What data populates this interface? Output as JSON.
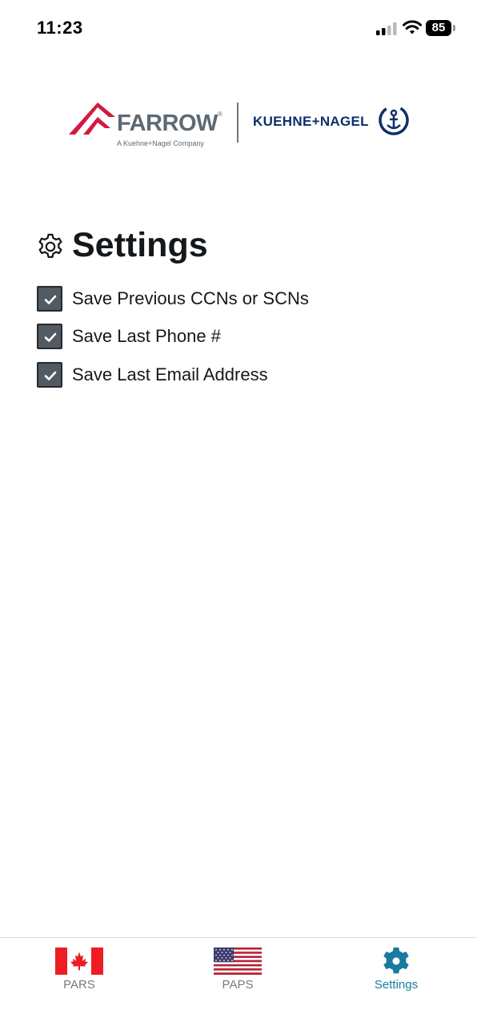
{
  "status_bar": {
    "time": "11:23",
    "battery_percent": "85"
  },
  "header": {
    "logo_farrow": "FARROW",
    "logo_farrow_registered": "®",
    "logo_farrow_tagline": "A Kuehne+Nagel Company",
    "logo_kuehne_nagel": "KUEHNE+NAGEL"
  },
  "settings": {
    "title": "Settings",
    "options": [
      {
        "label": "Save Previous CCNs or SCNs",
        "checked": true
      },
      {
        "label": "Save Last Phone #",
        "checked": true
      },
      {
        "label": "Save Last Email Address",
        "checked": true
      }
    ]
  },
  "tabs": [
    {
      "label": "PARS",
      "icon": "canada-flag-icon",
      "active": false
    },
    {
      "label": "PAPS",
      "icon": "usa-flag-icon",
      "active": false
    },
    {
      "label": "Settings",
      "icon": "gear-icon",
      "active": true
    }
  ],
  "colors": {
    "checkbox_fill": "#525a63",
    "active_tab": "#1a7aa0",
    "farrow_red": "#d3193f",
    "kn_blue": "#0c2f6b"
  }
}
